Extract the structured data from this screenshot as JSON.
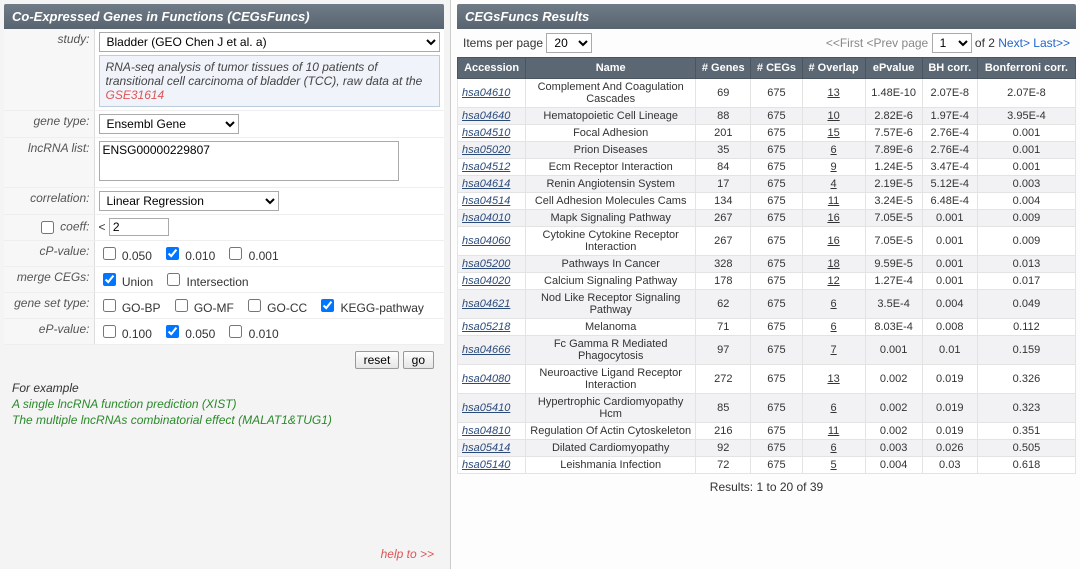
{
  "left": {
    "header": "Co-Expressed Genes in Functions (CEGsFuncs)",
    "labels": {
      "study": "study:",
      "geneType": "gene type:",
      "lncrnaList": "lncRNA list:",
      "correlation": "correlation:",
      "coeff": "coeff:",
      "cpvalue": "cP-value:",
      "mergeCEGs": "merge CEGs:",
      "geneSetType": "gene set type:",
      "epvalue": "eP-value:"
    },
    "study": {
      "selected": "Bladder (GEO Chen J et al. a)",
      "desc_prefix": "RNA-seq analysis of tumor tissues of 10 patients of transitional cell carcinoma of bladder (TCC), raw data at the ",
      "desc_link": "GSE31614"
    },
    "geneType": {
      "selected": "Ensembl Gene"
    },
    "lncrnaValue": "ENSG00000229807",
    "correlation": {
      "selected": "Linear Regression"
    },
    "coeffOp": "<",
    "coeffVal": "2",
    "cpOptions": [
      {
        "label": "0.050",
        "checked": false
      },
      {
        "label": "0.010",
        "checked": true
      },
      {
        "label": "0.001",
        "checked": false
      }
    ],
    "mergeOptions": [
      {
        "label": "Union",
        "checked": true
      },
      {
        "label": "Intersection",
        "checked": false
      }
    ],
    "gsOptions": [
      {
        "label": "GO-BP",
        "checked": false
      },
      {
        "label": "GO-MF",
        "checked": false
      },
      {
        "label": "GO-CC",
        "checked": false
      },
      {
        "label": "KEGG-pathway",
        "checked": true
      }
    ],
    "epOptions": [
      {
        "label": "0.100",
        "checked": false
      },
      {
        "label": "0.050",
        "checked": true
      },
      {
        "label": "0.010",
        "checked": false
      }
    ],
    "buttons": {
      "reset": "reset",
      "go": "go"
    },
    "example": {
      "title": "For example",
      "link1": "A single lncRNA function prediction (XIST)",
      "link2": "The multiple lncRNAs combinatorial effect (MALAT1&TUG1)"
    },
    "help": "help to >>"
  },
  "right": {
    "header": "CEGsFuncs Results",
    "itemsPerPageLabel": "Items per page",
    "itemsPerPageValue": "20",
    "pager": {
      "first": "<<First",
      "prev": "<Prev page",
      "current": "1",
      "of": "of 2",
      "next": "Next>",
      "last": "Last>>"
    },
    "columns": [
      "Accession",
      "Name",
      "# Genes",
      "# CEGs",
      "# Overlap",
      "ePvalue",
      "BH corr.",
      "Bonferroni corr."
    ],
    "rows": [
      {
        "acc": "hsa04610",
        "name": "Complement And Coagulation Cascades",
        "genes": "69",
        "cegs": "675",
        "overlap": "13",
        "ep": "1.48E-10",
        "bh": "2.07E-8",
        "bon": "2.07E-8"
      },
      {
        "acc": "hsa04640",
        "name": "Hematopoietic Cell Lineage",
        "genes": "88",
        "cegs": "675",
        "overlap": "10",
        "ep": "2.82E-6",
        "bh": "1.97E-4",
        "bon": "3.95E-4"
      },
      {
        "acc": "hsa04510",
        "name": "Focal Adhesion",
        "genes": "201",
        "cegs": "675",
        "overlap": "15",
        "ep": "7.57E-6",
        "bh": "2.76E-4",
        "bon": "0.001"
      },
      {
        "acc": "hsa05020",
        "name": "Prion Diseases",
        "genes": "35",
        "cegs": "675",
        "overlap": "6",
        "ep": "7.89E-6",
        "bh": "2.76E-4",
        "bon": "0.001"
      },
      {
        "acc": "hsa04512",
        "name": "Ecm Receptor Interaction",
        "genes": "84",
        "cegs": "675",
        "overlap": "9",
        "ep": "1.24E-5",
        "bh": "3.47E-4",
        "bon": "0.001"
      },
      {
        "acc": "hsa04614",
        "name": "Renin Angiotensin System",
        "genes": "17",
        "cegs": "675",
        "overlap": "4",
        "ep": "2.19E-5",
        "bh": "5.12E-4",
        "bon": "0.003"
      },
      {
        "acc": "hsa04514",
        "name": "Cell Adhesion Molecules Cams",
        "genes": "134",
        "cegs": "675",
        "overlap": "11",
        "ep": "3.24E-5",
        "bh": "6.48E-4",
        "bon": "0.004"
      },
      {
        "acc": "hsa04010",
        "name": "Mapk Signaling Pathway",
        "genes": "267",
        "cegs": "675",
        "overlap": "16",
        "ep": "7.05E-5",
        "bh": "0.001",
        "bon": "0.009"
      },
      {
        "acc": "hsa04060",
        "name": "Cytokine Cytokine Receptor Interaction",
        "genes": "267",
        "cegs": "675",
        "overlap": "16",
        "ep": "7.05E-5",
        "bh": "0.001",
        "bon": "0.009"
      },
      {
        "acc": "hsa05200",
        "name": "Pathways In Cancer",
        "genes": "328",
        "cegs": "675",
        "overlap": "18",
        "ep": "9.59E-5",
        "bh": "0.001",
        "bon": "0.013"
      },
      {
        "acc": "hsa04020",
        "name": "Calcium Signaling Pathway",
        "genes": "178",
        "cegs": "675",
        "overlap": "12",
        "ep": "1.27E-4",
        "bh": "0.001",
        "bon": "0.017"
      },
      {
        "acc": "hsa04621",
        "name": "Nod Like Receptor Signaling Pathway",
        "genes": "62",
        "cegs": "675",
        "overlap": "6",
        "ep": "3.5E-4",
        "bh": "0.004",
        "bon": "0.049"
      },
      {
        "acc": "hsa05218",
        "name": "Melanoma",
        "genes": "71",
        "cegs": "675",
        "overlap": "6",
        "ep": "8.03E-4",
        "bh": "0.008",
        "bon": "0.112"
      },
      {
        "acc": "hsa04666",
        "name": "Fc Gamma R Mediated Phagocytosis",
        "genes": "97",
        "cegs": "675",
        "overlap": "7",
        "ep": "0.001",
        "bh": "0.01",
        "bon": "0.159"
      },
      {
        "acc": "hsa04080",
        "name": "Neuroactive Ligand Receptor Interaction",
        "genes": "272",
        "cegs": "675",
        "overlap": "13",
        "ep": "0.002",
        "bh": "0.019",
        "bon": "0.326"
      },
      {
        "acc": "hsa05410",
        "name": "Hypertrophic Cardiomyopathy Hcm",
        "genes": "85",
        "cegs": "675",
        "overlap": "6",
        "ep": "0.002",
        "bh": "0.019",
        "bon": "0.323"
      },
      {
        "acc": "hsa04810",
        "name": "Regulation Of Actin Cytoskeleton",
        "genes": "216",
        "cegs": "675",
        "overlap": "11",
        "ep": "0.002",
        "bh": "0.019",
        "bon": "0.351"
      },
      {
        "acc": "hsa05414",
        "name": "Dilated Cardiomyopathy",
        "genes": "92",
        "cegs": "675",
        "overlap": "6",
        "ep": "0.003",
        "bh": "0.026",
        "bon": "0.505"
      },
      {
        "acc": "hsa05140",
        "name": "Leishmania Infection",
        "genes": "72",
        "cegs": "675",
        "overlap": "5",
        "ep": "0.004",
        "bh": "0.03",
        "bon": "0.618"
      }
    ],
    "footer": "Results: 1 to 20 of 39"
  }
}
